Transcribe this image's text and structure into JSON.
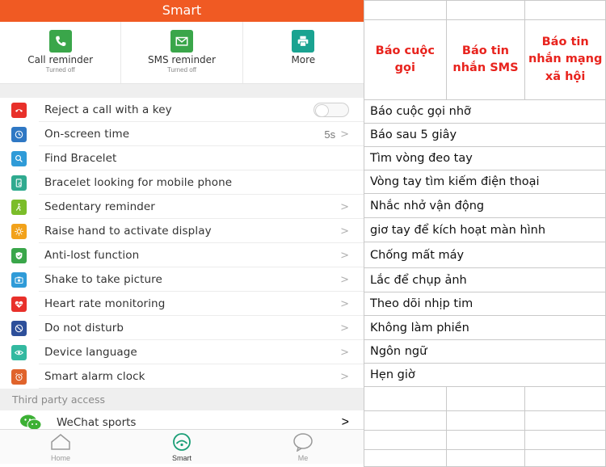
{
  "app": {
    "title": "Smart"
  },
  "quick_actions": [
    {
      "label": "Call reminder",
      "sub": "Turned off",
      "icon": "phone-icon",
      "color": "#3aa64a"
    },
    {
      "label": "SMS reminder",
      "sub": "Turned off",
      "icon": "mail-icon",
      "color": "#3aa64a"
    },
    {
      "label": "More",
      "sub": "",
      "icon": "printer-icon",
      "color": "#1aa391"
    }
  ],
  "menu": [
    {
      "label": "Reject a call with a key",
      "icon": "reject-call-icon",
      "color": "#e8302a",
      "control": "toggle",
      "value": ""
    },
    {
      "label": "On-screen time",
      "icon": "clock-icon",
      "color": "#2f78c4",
      "control": "chevron",
      "value": "5s"
    },
    {
      "label": "Find Bracelet",
      "icon": "search-icon",
      "color": "#2f9bd8",
      "control": "none",
      "value": ""
    },
    {
      "label": "Bracelet looking for mobile phone",
      "icon": "phone-search-icon",
      "color": "#2faa8f",
      "control": "none",
      "value": ""
    },
    {
      "label": "Sedentary reminder",
      "icon": "walking-icon",
      "color": "#7bbd2a",
      "control": "chevron",
      "value": ""
    },
    {
      "label": "Raise hand to activate display",
      "icon": "sun-icon",
      "color": "#f2a21b",
      "control": "chevron",
      "value": ""
    },
    {
      "label": "Anti-lost function",
      "icon": "shield-icon",
      "color": "#3aa64a",
      "control": "chevron",
      "value": ""
    },
    {
      "label": "Shake to take picture",
      "icon": "camera-icon",
      "color": "#2f9bd8",
      "control": "chevron",
      "value": ""
    },
    {
      "label": "Heart rate monitoring",
      "icon": "heart-rate-icon",
      "color": "#e8302a",
      "control": "chevron",
      "value": ""
    },
    {
      "label": "Do not disturb",
      "icon": "no-entry-icon",
      "color": "#2d4f9a",
      "control": "chevron",
      "value": ""
    },
    {
      "label": "Device language",
      "icon": "eye-icon",
      "color": "#33b9a0",
      "control": "chevron",
      "value": ""
    },
    {
      "label": "Smart alarm clock",
      "icon": "alarm-icon",
      "color": "#e0632b",
      "control": "chevron",
      "value": ""
    }
  ],
  "section_title": "Third party access",
  "wechat": {
    "label": "WeChat sports",
    "icon": "wechat-icon",
    "color": "#3cb034"
  },
  "tabs": [
    {
      "label": "Home",
      "icon": "home-icon"
    },
    {
      "label": "Smart",
      "icon": "smart-icon"
    },
    {
      "label": "Me",
      "icon": "user-icon"
    }
  ],
  "chevron": ">",
  "table": {
    "headers": [
      "Báo cuộc gọi",
      "Báo tin nhắn SMS",
      "Báo tin nhắn mạng xã hội"
    ],
    "rows": [
      "Báo cuộc gọi nhỡ",
      "Báo sau 5 giây",
      "Tìm vòng đeo tay",
      "Vòng tay tìm kiếm điện thoại",
      "Nhắc nhở vận động",
      "giơ tay để kích hoạt màn hình",
      "Chống mất máy",
      "Lắc để chụp ảnh",
      "Theo dõi nhịp tim",
      "Không làm phiền",
      "Ngôn ngữ",
      "Hẹn giờ"
    ]
  }
}
